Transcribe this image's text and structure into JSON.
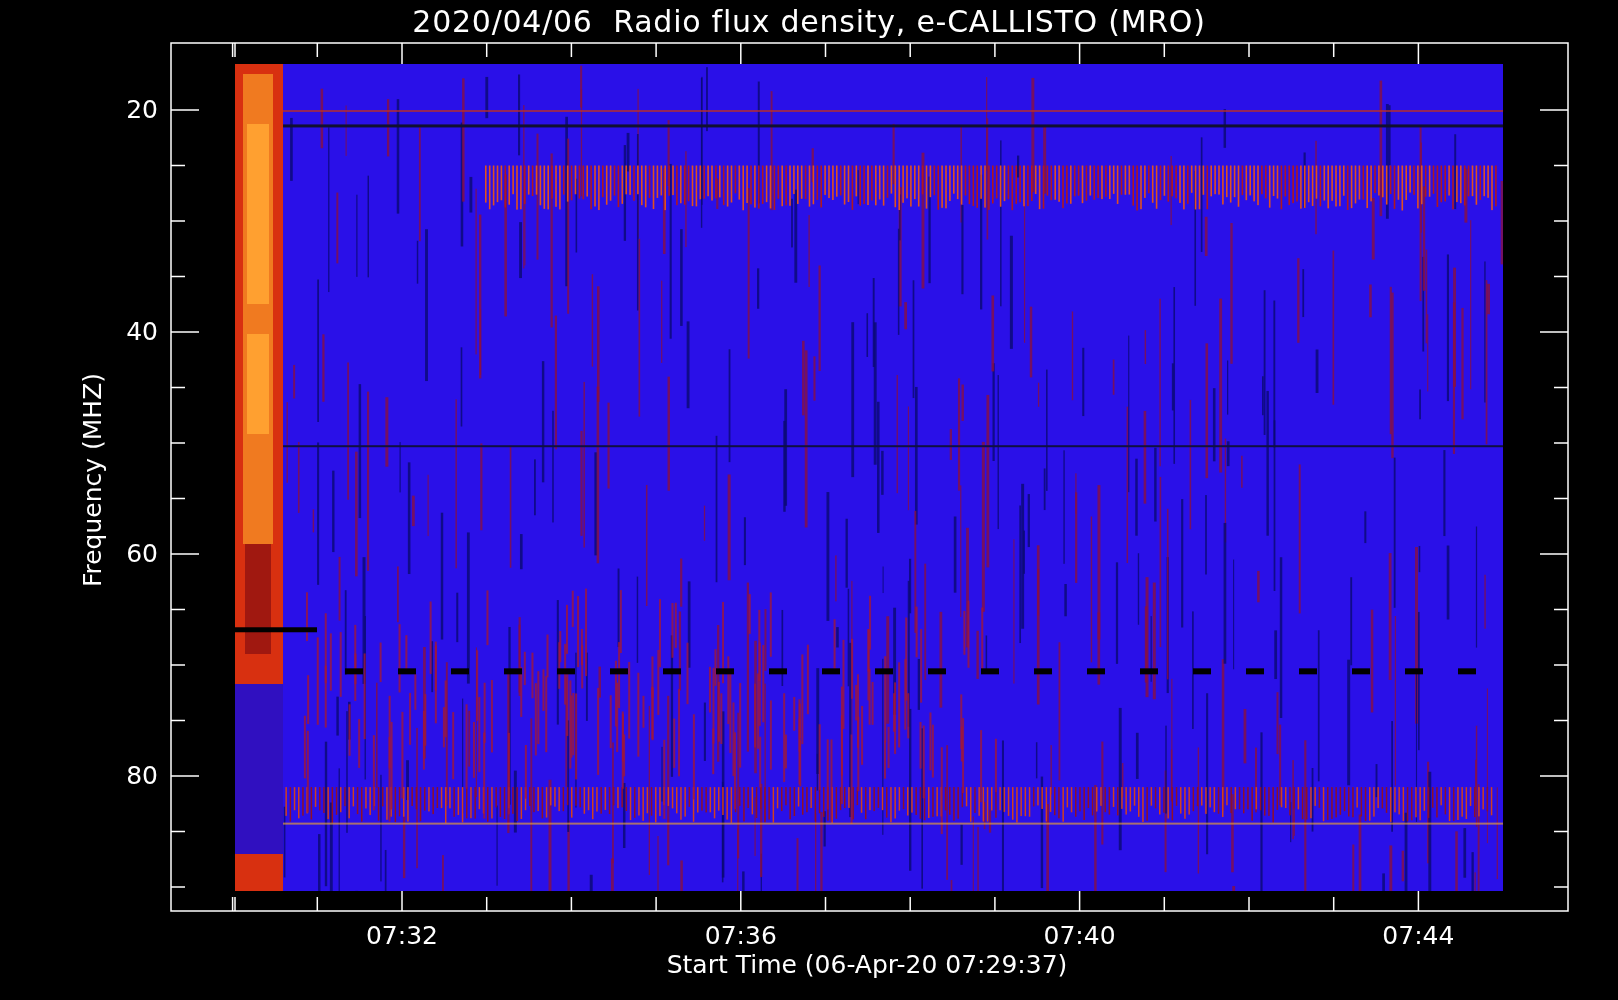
{
  "title": "2020/04/06  Radio flux density, e-CALLISTO (MRO)",
  "plot": {
    "y_axis": {
      "label": "Frequency (MHZ)",
      "ticks": [
        "20",
        "40",
        "60",
        "80"
      ]
    },
    "x_axis": {
      "label": "Start Time (06-Apr-20 07:29:37)",
      "ticks": [
        "07:32",
        "07:36",
        "07:40",
        "07:44"
      ]
    }
  }
}
